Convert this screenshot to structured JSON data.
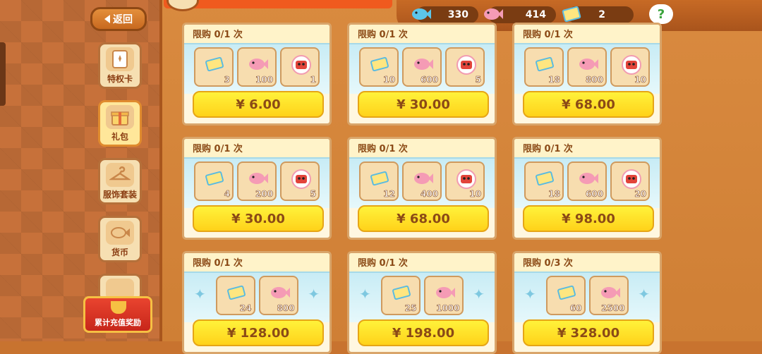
{
  "nav": {
    "back_label": "返回"
  },
  "sidebar": {
    "tabs": [
      {
        "label": "特权卡",
        "icon": "privilege-card-icon"
      },
      {
        "label": "礼包",
        "icon": "gift-box-icon"
      },
      {
        "label": "服饰套装",
        "icon": "hanger-icon"
      },
      {
        "label": "货币",
        "icon": "fish-coin-icon"
      }
    ],
    "reward_label": "累计充值奖励"
  },
  "currency": {
    "blue_fish": "330",
    "pink_fish": "414",
    "tickets": "2",
    "help": "?"
  },
  "packs": [
    {
      "limit": "限购 0/1 次",
      "items": [
        {
          "icon": "ticket-icon",
          "qty": "3"
        },
        {
          "icon": "pink-fish-icon",
          "qty": "100"
        },
        {
          "icon": "flower-token-icon",
          "qty": "1"
        }
      ],
      "price": "¥ 6.00"
    },
    {
      "limit": "限购 0/1 次",
      "items": [
        {
          "icon": "ticket-icon",
          "qty": "10"
        },
        {
          "icon": "pink-fish-icon",
          "qty": "600"
        },
        {
          "icon": "flower-token-icon",
          "qty": "5"
        }
      ],
      "price": "¥ 30.00"
    },
    {
      "limit": "限购 0/1 次",
      "items": [
        {
          "icon": "ticket-icon",
          "qty": "18"
        },
        {
          "icon": "pink-fish-icon",
          "qty": "800"
        },
        {
          "icon": "flower-token-icon",
          "qty": "10"
        }
      ],
      "price": "¥ 68.00"
    },
    {
      "limit": "限购 0/1 次",
      "items": [
        {
          "icon": "ticket-icon",
          "qty": "4"
        },
        {
          "icon": "pink-fish-icon",
          "qty": "200"
        },
        {
          "icon": "flower-token-icon",
          "qty": "5"
        }
      ],
      "price": "¥ 30.00"
    },
    {
      "limit": "限购 0/1 次",
      "items": [
        {
          "icon": "ticket-icon",
          "qty": "12"
        },
        {
          "icon": "pink-fish-icon",
          "qty": "400"
        },
        {
          "icon": "flower-token-icon",
          "qty": "10"
        }
      ],
      "price": "¥ 68.00"
    },
    {
      "limit": "限购 0/1 次",
      "items": [
        {
          "icon": "ticket-icon",
          "qty": "18"
        },
        {
          "icon": "pink-fish-icon",
          "qty": "600"
        },
        {
          "icon": "flower-token-icon",
          "qty": "20"
        }
      ],
      "price": "¥ 98.00"
    },
    {
      "limit": "限购 0/1 次",
      "items": [
        {
          "icon": "ticket-icon",
          "qty": "24"
        },
        {
          "icon": "pink-fish-icon",
          "qty": "800"
        }
      ],
      "price": "¥ 128.00"
    },
    {
      "limit": "限购 0/1 次",
      "items": [
        {
          "icon": "ticket-icon",
          "qty": "25"
        },
        {
          "icon": "pink-fish-icon",
          "qty": "1000"
        }
      ],
      "price": "¥ 198.00"
    },
    {
      "limit": "限购 0/3 次",
      "items": [
        {
          "icon": "ticket-icon",
          "qty": "60"
        },
        {
          "icon": "pink-fish-icon",
          "qty": "2500"
        }
      ],
      "price": "¥ 328.00"
    }
  ]
}
